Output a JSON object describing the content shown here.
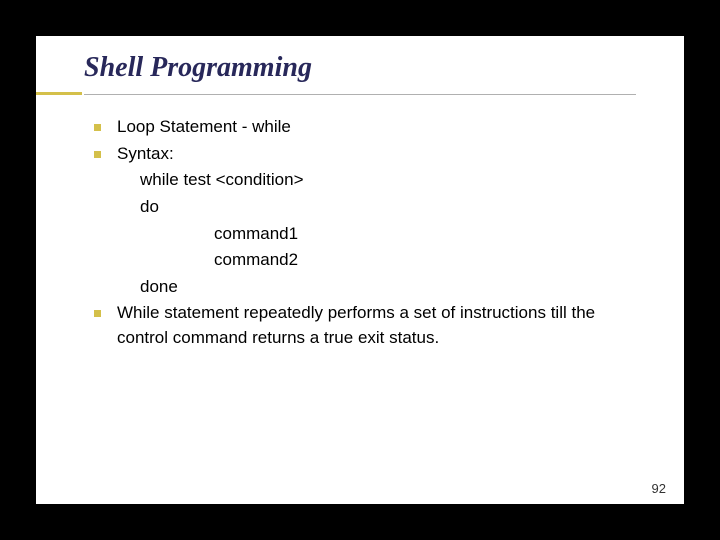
{
  "title": "Shell Programming",
  "bullets": {
    "b0": "Loop Statement - while",
    "b1": "Syntax:",
    "b2": "While statement repeatedly performs a set of instructions till the control command returns a true exit status."
  },
  "syntax": {
    "line0": "while test <condition>",
    "line1": "do",
    "line2": "command1",
    "line3": "command2",
    "line4": "done"
  },
  "page_number": "92"
}
